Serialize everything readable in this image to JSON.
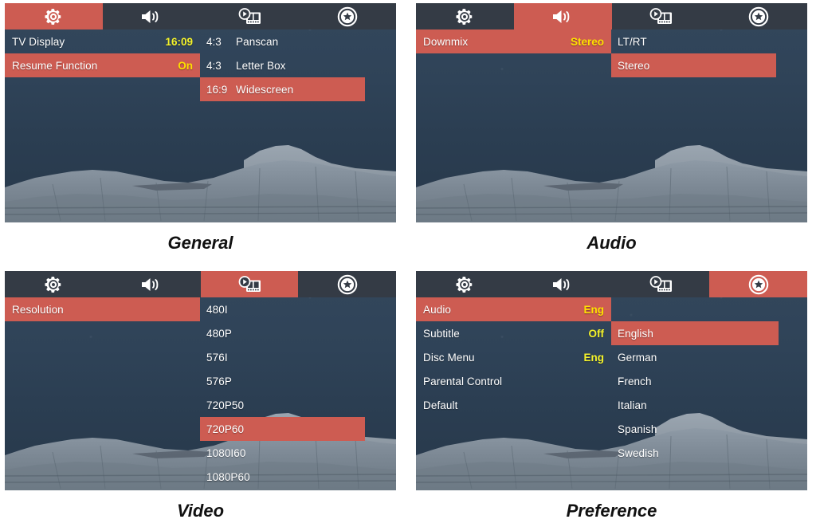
{
  "colors": {
    "highlight": "#cd5c52",
    "tab_bar": "#343b45",
    "value_yellow": "#f5f32a",
    "text_white": "#ffffff",
    "screen_bg": "#2c3e52"
  },
  "tabs": [
    {
      "icon": "gear-icon",
      "name": "general"
    },
    {
      "icon": "speaker-icon",
      "name": "audio"
    },
    {
      "icon": "video-film-icon",
      "name": "video"
    },
    {
      "icon": "star-circle-icon",
      "name": "preference"
    }
  ],
  "panels": [
    {
      "id": "general",
      "caption": "General",
      "active_tab": 0,
      "menu": [
        {
          "label": "TV Display",
          "value": "16:09",
          "highlighted": false
        },
        {
          "label": "Resume Function",
          "value": "On",
          "highlighted": true
        }
      ],
      "submenu": {
        "offset_rows": 0,
        "items": [
          {
            "prefix": "4:3",
            "label": "Panscan",
            "highlighted": false
          },
          {
            "prefix": "4:3",
            "label": "Letter Box",
            "highlighted": false
          },
          {
            "prefix": "16:9",
            "label": "Widescreen",
            "highlighted": true
          }
        ]
      }
    },
    {
      "id": "audio",
      "caption": "Audio",
      "active_tab": 1,
      "menu": [
        {
          "label": "Downmix",
          "value": "Stereo",
          "highlighted": true
        }
      ],
      "submenu": {
        "offset_rows": 0,
        "items": [
          {
            "prefix": "",
            "label": "LT/RT",
            "highlighted": false
          },
          {
            "prefix": "",
            "label": "Stereo",
            "highlighted": true
          }
        ]
      }
    },
    {
      "id": "video",
      "caption": "Video",
      "active_tab": 2,
      "menu": [
        {
          "label": "Resolution",
          "value": "",
          "highlighted": true
        }
      ],
      "submenu": {
        "offset_rows": 0,
        "items": [
          {
            "prefix": "",
            "label": "480I",
            "highlighted": false
          },
          {
            "prefix": "",
            "label": "480P",
            "highlighted": false
          },
          {
            "prefix": "",
            "label": "576I",
            "highlighted": false
          },
          {
            "prefix": "",
            "label": "576P",
            "highlighted": false
          },
          {
            "prefix": "",
            "label": "720P50",
            "highlighted": false
          },
          {
            "prefix": "",
            "label": "720P60",
            "highlighted": true
          },
          {
            "prefix": "",
            "label": "1080I60",
            "highlighted": false
          },
          {
            "prefix": "",
            "label": "1080P60",
            "highlighted": false
          }
        ]
      }
    },
    {
      "id": "preference",
      "caption": "Preference",
      "active_tab": 3,
      "menu": [
        {
          "label": "Audio",
          "value": "Eng",
          "highlighted": true
        },
        {
          "label": "Subtitle",
          "value": "Off",
          "highlighted": false
        },
        {
          "label": "Disc Menu",
          "value": "Eng",
          "highlighted": false
        },
        {
          "label": "Parental Control",
          "value": "",
          "highlighted": false
        },
        {
          "label": "Default",
          "value": "",
          "highlighted": false
        }
      ],
      "submenu": {
        "offset_rows": 1,
        "items": [
          {
            "prefix": "",
            "label": "English",
            "highlighted": true
          },
          {
            "prefix": "",
            "label": "German",
            "highlighted": false
          },
          {
            "prefix": "",
            "label": "French",
            "highlighted": false
          },
          {
            "prefix": "",
            "label": "Italian",
            "highlighted": false
          },
          {
            "prefix": "",
            "label": "Spanish",
            "highlighted": false
          },
          {
            "prefix": "",
            "label": "Swedish",
            "highlighted": false
          }
        ]
      }
    }
  ]
}
